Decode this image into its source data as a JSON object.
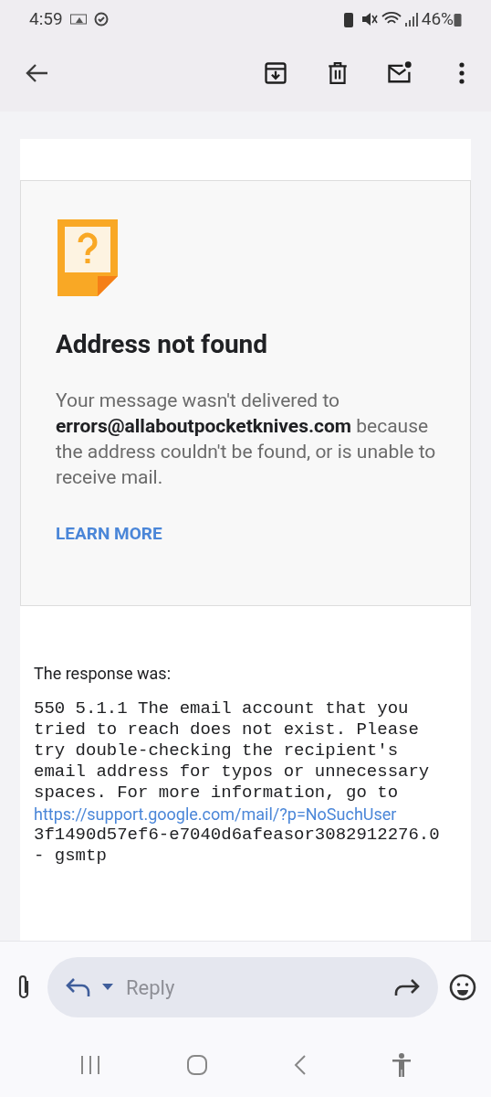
{
  "status_bar": {
    "time": "4:59",
    "battery": "46%"
  },
  "bounce": {
    "title": "Address not found",
    "message": "Your message wasn't delivered to **errors@allaboutpocketknives.com** because the address couldn't be found, or is unable to receive mail.",
    "link": "LEARN MORE"
  },
  "response": {
    "heading": "The response was:",
    "lines": [
      {
        "kind": "mono",
        "text": "550 5.1.1 The email account that you"
      },
      {
        "kind": "mono",
        "text": "tried to reach does not exist. Please"
      },
      {
        "kind": "mono",
        "text": "try double-checking the recipient's"
      },
      {
        "kind": "mono",
        "text": "email address for typos or unnecessary"
      },
      {
        "kind": "mono",
        "text": "spaces. For more information, go to"
      },
      {
        "kind": "link",
        "text": "https://support.google.com/mail/?p=NoSuchUser"
      },
      {
        "kind": "mono",
        "text": "3f1490d57ef6-e7040d6afeasor3082912276.0"
      },
      {
        "kind": "mono",
        "text": "- gsmtp"
      }
    ]
  },
  "reply_bar": {
    "placeholder": "Reply"
  }
}
